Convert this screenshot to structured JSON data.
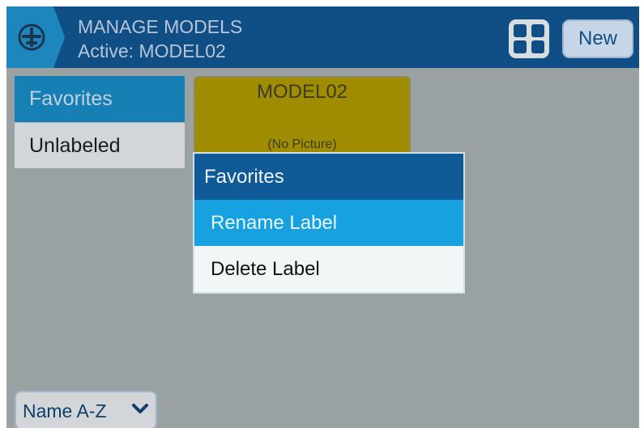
{
  "header": {
    "title": "MANAGE MODELS",
    "subtitle": "Active: MODEL02",
    "icon": "airplane-circle-icon",
    "grid_icon": "grid-view-icon",
    "new_label": "New"
  },
  "labels": {
    "items": [
      {
        "label": "Favorites",
        "selected": true
      },
      {
        "label": "Unlabeled",
        "selected": false
      }
    ]
  },
  "model": {
    "name": "MODEL02",
    "picture_text": "(No Picture)",
    "color": "#9f8c00"
  },
  "sort": {
    "value": "Name A-Z",
    "icon": "chevron-down-icon"
  },
  "menu": {
    "title": "Favorites",
    "items": [
      {
        "label": "Rename Label",
        "highlighted": true
      },
      {
        "label": "Delete Label",
        "highlighted": false
      }
    ]
  },
  "colors": {
    "header_bg": "#0f4f86",
    "accent": "#167fb4",
    "highlight": "#17a1e0",
    "background": "#9aa1a3"
  }
}
